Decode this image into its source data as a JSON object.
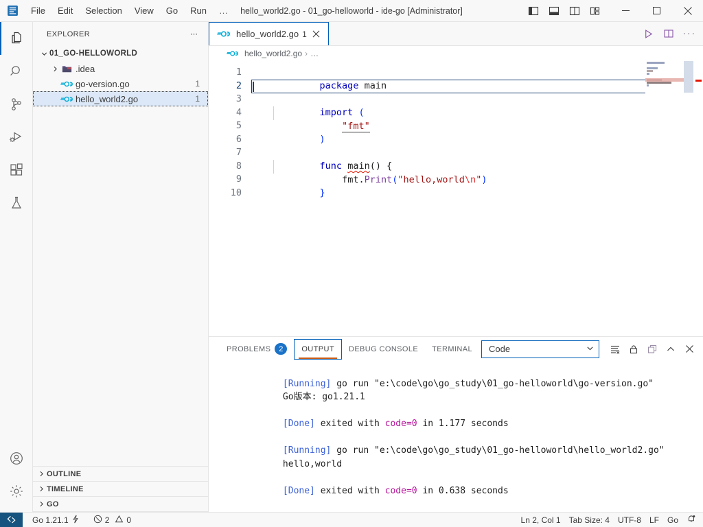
{
  "titlebar": {
    "logo_icon": "vscode-logo-icon",
    "menu": [
      {
        "label": "File",
        "name": "menu-file"
      },
      {
        "label": "Edit",
        "name": "menu-edit"
      },
      {
        "label": "Selection",
        "name": "menu-selection"
      },
      {
        "label": "View",
        "name": "menu-view"
      },
      {
        "label": "Go",
        "name": "menu-go"
      },
      {
        "label": "Run",
        "name": "menu-run"
      },
      {
        "label": "…",
        "name": "menu-more"
      }
    ],
    "title": "hello_world2.go - 01_go-helloworld - ide-go [Administrator]",
    "layout_icons": [
      "toggle-primary-sidebar-icon",
      "toggle-panel-icon",
      "toggle-secondary-sidebar-icon",
      "customize-layout-icon"
    ],
    "window_controls": [
      "minimize-button",
      "maximize-button",
      "close-button"
    ]
  },
  "activitybar": {
    "items": [
      {
        "name": "activity-explorer",
        "icon": "files-icon",
        "active": true
      },
      {
        "name": "activity-search",
        "icon": "search-icon",
        "active": false
      },
      {
        "name": "activity-source-control",
        "icon": "source-control-icon",
        "active": false
      },
      {
        "name": "activity-run-debug",
        "icon": "run-and-debug-icon",
        "active": false
      },
      {
        "name": "activity-extensions",
        "icon": "extensions-icon",
        "active": false
      },
      {
        "name": "activity-testing",
        "icon": "beaker-icon",
        "active": false
      }
    ],
    "bottom_items": [
      {
        "name": "activity-accounts",
        "icon": "account-icon"
      },
      {
        "name": "activity-settings",
        "icon": "gear-icon"
      }
    ]
  },
  "sidebar": {
    "header": "EXPLORER",
    "header_actions": "⋯",
    "tree": [
      {
        "label": "01_GO-HELLOWORLD",
        "type": "folder-root",
        "depth": 0,
        "expanded": true,
        "count": "",
        "selected": false
      },
      {
        "label": ".idea",
        "type": "folder",
        "depth": 1,
        "expanded": false,
        "count": "",
        "selected": false
      },
      {
        "label": "go-version.go",
        "type": "go-file",
        "depth": 2,
        "expanded": null,
        "count": "1",
        "selected": false
      },
      {
        "label": "hello_world2.go",
        "type": "go-file",
        "depth": 2,
        "expanded": null,
        "count": "1",
        "selected": true
      }
    ],
    "sections": [
      {
        "label": "OUTLINE",
        "name": "sidebar-section-outline"
      },
      {
        "label": "TIMELINE",
        "name": "sidebar-section-timeline"
      },
      {
        "label": "GO",
        "name": "sidebar-section-go"
      }
    ]
  },
  "editor": {
    "tab": {
      "label": "hello_world2.go",
      "badge": "1",
      "icon": "go-file-icon",
      "close": "×"
    },
    "actions": [
      {
        "name": "run-code-button",
        "icon": "play-icon"
      },
      {
        "name": "split-editor-button",
        "icon": "split-editor-icon"
      },
      {
        "name": "editor-more-actions-button",
        "icon": "ellipsis-icon"
      }
    ],
    "breadcrumbs": [
      "hello_world2.go",
      "…"
    ],
    "line_numbers": [
      "1",
      "2",
      "3",
      "4",
      "5",
      "6",
      "7",
      "8",
      "9",
      "10"
    ],
    "active_line": 2,
    "code_lines": [
      {
        "n": 1,
        "segments": [
          {
            "t": "package ",
            "c": "kw"
          },
          {
            "t": "main",
            "c": "pkg"
          }
        ]
      },
      {
        "n": 2,
        "segments": []
      },
      {
        "n": 3,
        "segments": [
          {
            "t": "import ",
            "c": "kw"
          },
          {
            "t": "(",
            "c": "paren"
          }
        ]
      },
      {
        "n": 4,
        "segments": [
          {
            "t": "    ",
            "c": "punc"
          },
          {
            "t": "\"fmt\"",
            "c": "str-underline"
          }
        ]
      },
      {
        "n": 5,
        "segments": [
          {
            "t": ")",
            "c": "paren"
          }
        ]
      },
      {
        "n": 6,
        "segments": []
      },
      {
        "n": 7,
        "segments": [
          {
            "t": "func ",
            "c": "kw"
          },
          {
            "t": "main",
            "c": "squiggle"
          },
          {
            "t": "() {",
            "c": "punc"
          }
        ]
      },
      {
        "n": 8,
        "segments": [
          {
            "t": "    ",
            "c": "punc"
          },
          {
            "t": "fmt",
            "c": "pkg"
          },
          {
            "t": ".",
            "c": "punc"
          },
          {
            "t": "Print",
            "c": "fn"
          },
          {
            "t": "(",
            "c": "paren"
          },
          {
            "t": "\"hello,world",
            "c": "str"
          },
          {
            "t": "\\n",
            "c": "esc"
          },
          {
            "t": "\"",
            "c": "str"
          },
          {
            "t": ")",
            "c": "paren"
          }
        ]
      },
      {
        "n": 9,
        "segments": [
          {
            "t": "}",
            "c": "paren"
          }
        ]
      },
      {
        "n": 10,
        "segments": []
      }
    ]
  },
  "panel": {
    "tabs": [
      {
        "label": "PROBLEMS",
        "badge": "2",
        "active": false,
        "name": "panel-tab-problems"
      },
      {
        "label": "OUTPUT",
        "badge": "",
        "active": true,
        "name": "panel-tab-output"
      },
      {
        "label": "DEBUG CONSOLE",
        "badge": "",
        "active": false,
        "name": "panel-tab-debug-console"
      },
      {
        "label": "TERMINAL",
        "badge": "",
        "active": false,
        "name": "panel-tab-terminal"
      }
    ],
    "channel_select": {
      "value": "Code",
      "name": "output-channel-select"
    },
    "actions": [
      {
        "name": "clear-output-button",
        "icon": "clear-output-icon"
      },
      {
        "name": "lock-scrolling-button",
        "icon": "lock-icon"
      },
      {
        "name": "open-output-in-editor-button",
        "icon": "new-window-icon"
      },
      {
        "name": "maximize-panel-button",
        "icon": "chevron-up-icon"
      },
      {
        "name": "close-panel-button",
        "icon": "close-icon"
      }
    ],
    "output_lines": [
      [
        {
          "t": "[Running]",
          "c": "tok-tag"
        },
        {
          "t": " go run \"e:\\code\\go\\go_study\\01_go-helloworld\\go-version.go\"",
          "c": "tok-code"
        }
      ],
      [
        {
          "t": "Go版本: go1.21.1",
          "c": "tok-code"
        }
      ],
      [],
      [
        {
          "t": "[Done]",
          "c": "tok-tag"
        },
        {
          "t": " exited with ",
          "c": "tok-code"
        },
        {
          "t": "code=0",
          "c": "tok-num"
        },
        {
          "t": " in 1.177 seconds",
          "c": "tok-code"
        }
      ],
      [],
      [
        {
          "t": "[Running]",
          "c": "tok-tag"
        },
        {
          "t": " go run \"e:\\code\\go\\go_study\\01_go-helloworld\\hello_world2.go\"",
          "c": "tok-code"
        }
      ],
      [
        {
          "t": "hello,world",
          "c": "tok-code"
        }
      ],
      [],
      [
        {
          "t": "[Done]",
          "c": "tok-tag"
        },
        {
          "t": " exited with ",
          "c": "tok-code"
        },
        {
          "t": "code=0",
          "c": "tok-num"
        },
        {
          "t": " in 0.638 seconds",
          "c": "tok-code"
        }
      ]
    ]
  },
  "statusbar": {
    "remote_icon": "remote-window-icon",
    "left": [
      {
        "label": "Go 1.21.1",
        "icon": "flash-icon",
        "name": "status-go-version"
      },
      {
        "label": "2",
        "icon": "error-icon",
        "label2": "0",
        "icon2": "warning-icon",
        "name": "status-problems"
      }
    ],
    "right": [
      {
        "label": "Ln 2, Col 1",
        "name": "status-cursor-position"
      },
      {
        "label": "Tab Size: 4",
        "name": "status-tab-size"
      },
      {
        "label": "UTF-8",
        "name": "status-encoding"
      },
      {
        "label": "LF",
        "name": "status-eol"
      },
      {
        "label": "Go",
        "name": "status-language-mode"
      },
      {
        "label": "",
        "icon": "bell-dot-icon",
        "name": "status-notifications"
      }
    ]
  },
  "colors": {
    "accent": "#005fb8",
    "badge": "#1a73c8",
    "remote": "#16537e",
    "error": "#e51400",
    "underline_active_tab": "#c75b15"
  }
}
